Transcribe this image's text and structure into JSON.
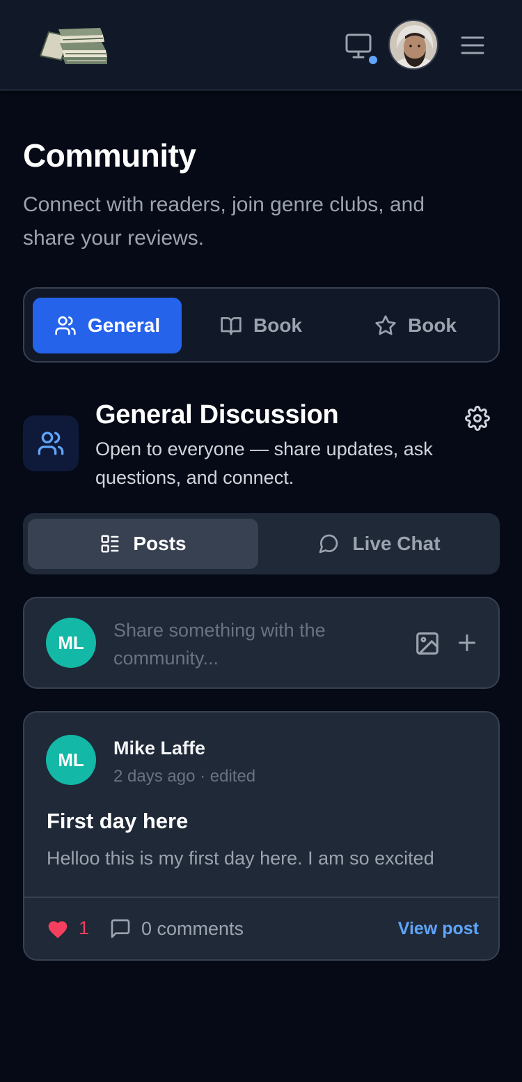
{
  "header": {
    "logo_icon": "stacked-books-logo",
    "monitor_icon": "monitor-icon",
    "avatar_icon": "user-avatar-photo",
    "menu_icon": "hamburger-menu-icon"
  },
  "page": {
    "title": "Community",
    "subtitle": "Connect with readers, join genre clubs, and share your reviews."
  },
  "club_tabs": [
    {
      "label": "General",
      "icon": "users-icon",
      "active": true
    },
    {
      "label": "Book",
      "icon": "book-open-icon",
      "active": false
    },
    {
      "label": "Book",
      "icon": "star-icon",
      "active": false
    }
  ],
  "group": {
    "title": "General Discussion",
    "description": "Open to everyone — share updates, ask questions, and connect.",
    "icon": "users-icon",
    "settings_icon": "gear-icon"
  },
  "view_tabs": [
    {
      "label": "Posts",
      "icon": "list-icon",
      "active": true
    },
    {
      "label": "Live Chat",
      "icon": "chat-bubble-icon",
      "active": false
    }
  ],
  "composer": {
    "avatar_initials": "ML",
    "placeholder": "Share something with the community...",
    "image_icon": "image-icon",
    "plus_icon": "plus-icon"
  },
  "posts": [
    {
      "avatar_initials": "ML",
      "author": "Mike Laffe",
      "meta": "2 days ago · edited",
      "title": "First day here",
      "body": "Helloo this is my first day here. I am so excited",
      "likes": "1",
      "comments_label": "0 comments",
      "view_label": "View post"
    }
  ],
  "colors": {
    "background": "#050a16",
    "header": "#111827",
    "card": "#1f2937",
    "accent": "#2563eb",
    "avatar": "#14b8a6",
    "like": "#f43f5e",
    "link": "#60a5fa"
  }
}
